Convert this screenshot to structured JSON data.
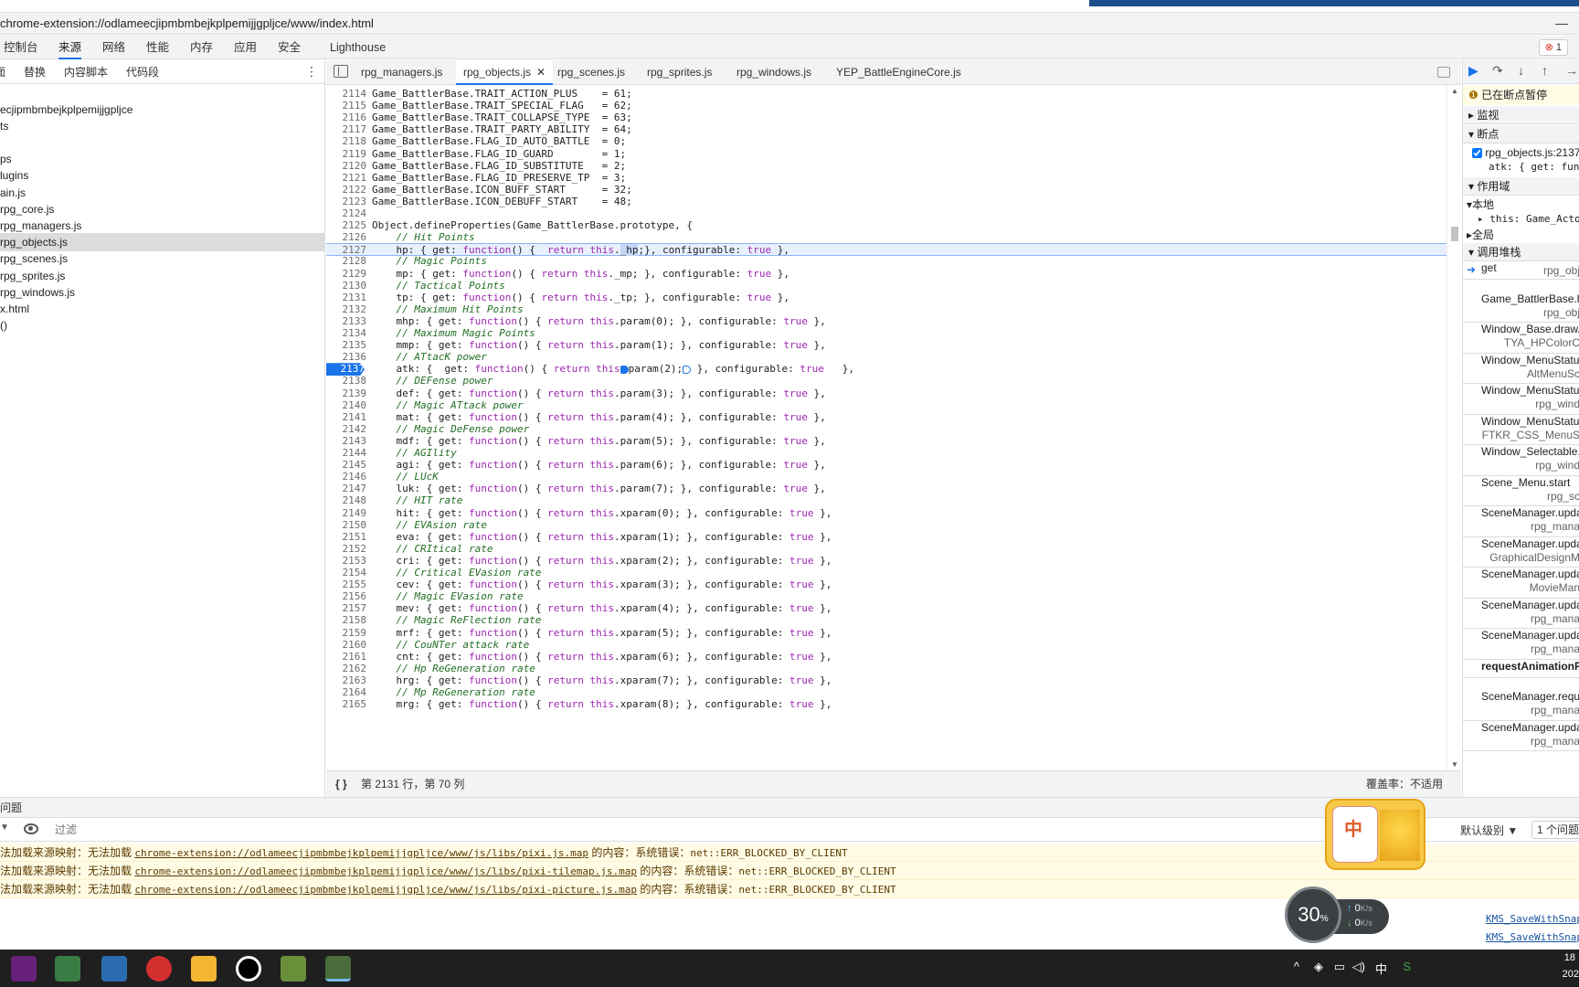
{
  "window": {
    "url": "chrome-extension://odlameecjipmbmbejkplpemijjgpljce/www/index.html"
  },
  "devtools_tabs": [
    "控制台",
    "来源",
    "网络",
    "性能",
    "内存",
    "应用",
    "安全",
    "Lighthouse"
  ],
  "active_tab": "来源",
  "error_badge": {
    "icon": "error-circle-icon",
    "count": "1"
  },
  "left_sub_tabs": [
    "页面",
    "替换",
    "内容脚本",
    "代码段"
  ],
  "file_tree": [
    {
      "label": "ecjipmbmbejkplpemijjgpljce",
      "selected": false
    },
    {
      "label": "ts",
      "selected": false
    },
    {
      "label": "",
      "selected": false
    },
    {
      "label": "ps",
      "selected": false
    },
    {
      "label": "lugins",
      "selected": false
    },
    {
      "label": "ain.js",
      "selected": false
    },
    {
      "label": "rpg_core.js",
      "selected": false
    },
    {
      "label": "rpg_managers.js",
      "selected": false
    },
    {
      "label": "rpg_objects.js",
      "selected": true
    },
    {
      "label": "rpg_scenes.js",
      "selected": false
    },
    {
      "label": "rpg_sprites.js",
      "selected": false
    },
    {
      "label": "rpg_windows.js",
      "selected": false
    },
    {
      "label": "x.html",
      "selected": false
    },
    {
      "label": "()",
      "selected": false
    }
  ],
  "file_tabs": [
    "rpg_managers.js",
    "rpg_objects.js",
    "rpg_scenes.js",
    "rpg_sprites.js",
    "rpg_windows.js",
    "YEP_BattleEngineCore.js"
  ],
  "active_file": "rpg_objects.js",
  "code_lines": [
    {
      "n": "2114",
      "t": "Game_BattlerBase.TRAIT_ACTION_PLUS    = 61;"
    },
    {
      "n": "2115",
      "t": "Game_BattlerBase.TRAIT_SPECIAL_FLAG   = 62;"
    },
    {
      "n": "2116",
      "t": "Game_BattlerBase.TRAIT_COLLAPSE_TYPE  = 63;"
    },
    {
      "n": "2117",
      "t": "Game_BattlerBase.TRAIT_PARTY_ABILITY  = 64;"
    },
    {
      "n": "2118",
      "t": "Game_BattlerBase.FLAG_ID_AUTO_BATTLE  = 0;"
    },
    {
      "n": "2119",
      "t": "Game_BattlerBase.FLAG_ID_GUARD        = 1;"
    },
    {
      "n": "2120",
      "t": "Game_BattlerBase.FLAG_ID_SUBSTITUTE   = 2;"
    },
    {
      "n": "2121",
      "t": "Game_BattlerBase.FLAG_ID_PRESERVE_TP  = 3;"
    },
    {
      "n": "2122",
      "t": "Game_BattlerBase.ICON_BUFF_START      = 32;"
    },
    {
      "n": "2123",
      "t": "Game_BattlerBase.ICON_DEBUFF_START    = 48;"
    },
    {
      "n": "2124",
      "t": ""
    },
    {
      "n": "2125",
      "t": "Object.defineProperties(Game_BattlerBase.prototype, {"
    },
    {
      "n": "2126",
      "t": "    // Hit Points"
    },
    {
      "n": "2127",
      "t": "    hp: { get: function() {  return this._hp;}, configurable: true },"
    },
    {
      "n": "2128",
      "t": "    // Magic Points"
    },
    {
      "n": "2129",
      "t": "    mp: { get: function() { return this._mp; }, configurable: true },"
    },
    {
      "n": "2130",
      "t": "    // Tactical Points"
    },
    {
      "n": "2131",
      "t": "    tp: { get: function() { return this._tp; }, configurable: true },"
    },
    {
      "n": "2132",
      "t": "    // Maximum Hit Points"
    },
    {
      "n": "2133",
      "t": "    mhp: { get: function() { return this.param(0); }, configurable: true },"
    },
    {
      "n": "2134",
      "t": "    // Maximum Magic Points"
    },
    {
      "n": "2135",
      "t": "    mmp: { get: function() { return this.param(1); }, configurable: true },"
    },
    {
      "n": "2136",
      "t": "    // ATtacK power"
    },
    {
      "n": "2137",
      "t": "    atk: {  get: function() { return this.param(2); }, configurable: true   },"
    },
    {
      "n": "2138",
      "t": "    // DEFense power"
    },
    {
      "n": "2139",
      "t": "    def: { get: function() { return this.param(3); }, configurable: true },"
    },
    {
      "n": "2140",
      "t": "    // Magic ATtack power"
    },
    {
      "n": "2141",
      "t": "    mat: { get: function() { return this.param(4); }, configurable: true },"
    },
    {
      "n": "2142",
      "t": "    // Magic DeFense power"
    },
    {
      "n": "2143",
      "t": "    mdf: { get: function() { return this.param(5); }, configurable: true },"
    },
    {
      "n": "2144",
      "t": "    // AGIlity"
    },
    {
      "n": "2145",
      "t": "    agi: { get: function() { return this.param(6); }, configurable: true },"
    },
    {
      "n": "2146",
      "t": "    // LUcK"
    },
    {
      "n": "2147",
      "t": "    luk: { get: function() { return this.param(7); }, configurable: true },"
    },
    {
      "n": "2148",
      "t": "    // HIT rate"
    },
    {
      "n": "2149",
      "t": "    hit: { get: function() { return this.xparam(0); }, configurable: true },"
    },
    {
      "n": "2150",
      "t": "    // EVAsion rate"
    },
    {
      "n": "2151",
      "t": "    eva: { get: function() { return this.xparam(1); }, configurable: true },"
    },
    {
      "n": "2152",
      "t": "    // CRItical rate"
    },
    {
      "n": "2153",
      "t": "    cri: { get: function() { return this.xparam(2); }, configurable: true },"
    },
    {
      "n": "2154",
      "t": "    // Critical EVasion rate"
    },
    {
      "n": "2155",
      "t": "    cev: { get: function() { return this.xparam(3); }, configurable: true },"
    },
    {
      "n": "2156",
      "t": "    // Magic EVasion rate"
    },
    {
      "n": "2157",
      "t": "    mev: { get: function() { return this.xparam(4); }, configurable: true },"
    },
    {
      "n": "2158",
      "t": "    // Magic ReFlection rate"
    },
    {
      "n": "2159",
      "t": "    mrf: { get: function() { return this.xparam(5); }, configurable: true },"
    },
    {
      "n": "2160",
      "t": "    // CouNTer attack rate"
    },
    {
      "n": "2161",
      "t": "    cnt: { get: function() { return this.xparam(6); }, configurable: true },"
    },
    {
      "n": "2162",
      "t": "    // Hp ReGeneration rate"
    },
    {
      "n": "2163",
      "t": "    hrg: { get: function() { return this.xparam(7); }, configurable: true },"
    },
    {
      "n": "2164",
      "t": "    // Mp ReGeneration rate"
    },
    {
      "n": "2165",
      "t": "    mrg: { get: function() { return this.xparam(8); }, configurable: true },"
    }
  ],
  "highlight_line": "2127",
  "breakpoint_line": "2137",
  "status": {
    "position": "第 2131 行，第 70 列",
    "coverage": "覆盖率：不适用"
  },
  "debugger": {
    "paused": "已在断点暂停",
    "watch": "监视",
    "breakpoints": "断点",
    "bp_file": "rpg_objects.js:2137",
    "bp_code": "atk: { get: fun",
    "scope": "作用域",
    "local": "本地",
    "this_val": "this: Game_Actor",
    "global": "全局",
    "callstack": "调用堆栈",
    "frames": [
      {
        "fn": "get",
        "src": "rpg_obj"
      },
      {
        "fn": "Game_BattlerBase.hp",
        "src": "rpg_obj"
      },
      {
        "fn": "Window_Base.drawA",
        "src": "TYA_HPColorC"
      },
      {
        "fn": "Window_MenuStatus",
        "src": "AltMenuSc"
      },
      {
        "fn": "Window_MenuStatus",
        "src": "rpg_wind"
      },
      {
        "fn": "Window_MenuStatus",
        "src": "FTKR_CSS_MenuS"
      },
      {
        "fn": "Window_Selectable.r",
        "src": "rpg_wind"
      },
      {
        "fn": "Scene_Menu.start",
        "src": "rpg_sc"
      },
      {
        "fn": "SceneManager.upda",
        "src": "rpg_mana"
      },
      {
        "fn": "SceneManager.upda",
        "src": "GraphicalDesignM"
      },
      {
        "fn": "SceneManager.upda",
        "src": "MovieMan"
      },
      {
        "fn": "SceneManager.upda",
        "src": "rpg_mana"
      },
      {
        "fn": "SceneManager.upda",
        "src": "rpg_mana"
      },
      {
        "fn": "requestAnimationF",
        "src": ""
      },
      {
        "fn": "SceneManager.reque",
        "src": "rpg_mana"
      },
      {
        "fn": "SceneManager.upda",
        "src": "rpg_mana"
      }
    ]
  },
  "drawer": {
    "title": "问题",
    "filter_placeholder": "过滤",
    "levels": "默认级别 ▼",
    "issues": "1 个问题",
    "messages": [
      {
        "prefix": "法加载来源映射：无法加载 ",
        "url": "chrome-extension://odlameecjipmbmbejkplpemijjgpljce/www/js/libs/pixi.js.map",
        "suffix": " 的内容：系统错误：",
        "code": "net::ERR_BLOCKED_BY_CLIENT"
      },
      {
        "prefix": "法加载来源映射：无法加载 ",
        "url": "chrome-extension://odlameecjipmbmbejkplpemijjgpljce/www/js/libs/pixi-tilemap.js.map",
        "suffix": " 的内容：系统错误：",
        "code": "net::ERR_BLOCKED_BY_CLIENT"
      },
      {
        "prefix": "法加载来源映射：无法加载 ",
        "url": "chrome-extension://odlameecjipmbmbejkplpemijjgpljce/www/js/libs/pixi-picture.js.map",
        "suffix": " 的内容：系统错误：",
        "code": "net::ERR_BLOCKED_BY_CLIENT"
      }
    ],
    "kms": [
      "KMS_SaveWithSnap",
      "KMS_SaveWithSnap"
    ]
  },
  "ime": {
    "label": "中"
  },
  "netmon": {
    "percent": "30",
    "pct_sign": "%",
    "up": "0",
    "down": "0",
    "unit": "K/s"
  },
  "tray": {
    "lang": "中",
    "time": "18",
    "date": "202"
  }
}
